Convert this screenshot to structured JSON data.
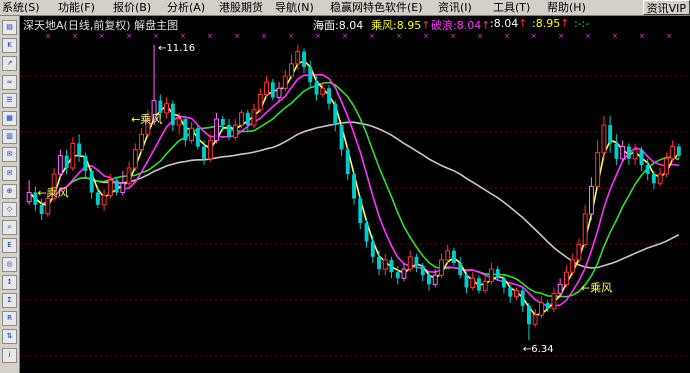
{
  "menu": {
    "items": [
      "系统(S)",
      "功能(F)",
      "报价(B)",
      "分析(A)",
      "港股期货",
      "导航(N)",
      "稳赢网特色软件(E)",
      "资讯(I)",
      "工具(T)",
      "帮助(H)"
    ],
    "right_button": "资讯VIP"
  },
  "chart_header": {
    "title": "深天地A(日线,前复权) 解盘主图"
  },
  "legend": {
    "haimian_label": "海面:",
    "haimian_value": "8.04",
    "chengfeng_label": "乘风:",
    "chengfeng_value": "8.95",
    "polang_label": "破浪:",
    "polang_value": "8.04",
    "v4": ":8.04",
    "v5": ":8.95",
    "v6": ":-:-"
  },
  "annotations": {
    "high_label": "11.16",
    "low_label": "6.34",
    "signal_label": "乘风"
  },
  "colors": {
    "up": "#ff3333",
    "down": "#00cccc",
    "ma_green": "#33dd33",
    "ma_magenta": "#ff33ff",
    "ma_white": "#c8c8c8",
    "ma_yellow": "#ffff66",
    "grid": "#7a0000",
    "haimian": "#ffffff",
    "chengfeng": "#ffff00",
    "polang": "#ff33ff"
  },
  "toolbar_icons": [
    "chart-icon",
    "k-line-icon",
    "trend-icon",
    "ma-icon",
    "list-icon",
    "grid-icon",
    "report-icon",
    "news-icon",
    "mail-icon",
    "zoom-icon",
    "filter-icon",
    "search-icon",
    "etf-icon",
    "cycle-icon",
    "rank-icon",
    "sum-icon",
    "rsi-icon",
    "sort-icon",
    "info-icon"
  ],
  "chart_data": {
    "type": "candlestick",
    "price_range": [
      6.0,
      11.5
    ],
    "candles": [
      [
        8.6,
        8.75,
        8.55,
        8.95
      ],
      [
        8.75,
        8.55,
        8.45,
        8.85
      ],
      [
        8.55,
        8.4,
        8.3,
        8.65
      ],
      [
        8.4,
        8.65,
        8.35,
        8.75
      ],
      [
        8.65,
        9.05,
        8.6,
        9.15
      ],
      [
        9.05,
        9.35,
        9.0,
        9.45
      ],
      [
        9.35,
        9.15,
        9.05,
        9.45
      ],
      [
        9.15,
        9.55,
        9.1,
        9.65
      ],
      [
        9.55,
        9.35,
        9.25,
        9.7
      ],
      [
        9.35,
        9.1,
        9.0,
        9.4
      ],
      [
        9.1,
        8.75,
        8.65,
        9.15
      ],
      [
        8.75,
        8.55,
        8.5,
        8.85
      ],
      [
        8.55,
        8.7,
        8.45,
        8.8
      ],
      [
        8.7,
        8.95,
        8.65,
        9.05
      ],
      [
        8.95,
        8.75,
        8.7,
        9.0
      ],
      [
        8.75,
        8.9,
        8.7,
        9.1
      ],
      [
        8.9,
        9.15,
        8.85,
        9.25
      ],
      [
        9.15,
        9.45,
        9.1,
        9.55
      ],
      [
        9.45,
        9.7,
        9.4,
        9.8
      ],
      [
        9.7,
        9.95,
        9.65,
        10.1
      ],
      [
        9.95,
        10.25,
        9.85,
        11.16
      ],
      [
        10.25,
        10.05,
        9.95,
        10.35
      ],
      [
        10.05,
        10.2,
        9.95,
        10.3
      ],
      [
        10.2,
        9.85,
        9.75,
        10.25
      ],
      [
        9.85,
        9.95,
        9.7,
        10.05
      ],
      [
        9.95,
        9.6,
        9.5,
        10.0
      ],
      [
        9.6,
        9.8,
        9.55,
        9.9
      ],
      [
        9.8,
        9.5,
        9.45,
        9.85
      ],
      [
        9.5,
        9.3,
        9.2,
        9.6
      ],
      [
        9.3,
        9.6,
        9.25,
        9.7
      ],
      [
        9.6,
        9.95,
        9.55,
        10.05
      ],
      [
        9.95,
        9.85,
        9.75,
        10.0
      ],
      [
        9.85,
        9.65,
        9.6,
        9.95
      ],
      [
        9.65,
        9.85,
        9.6,
        9.95
      ],
      [
        9.85,
        10.05,
        9.8,
        10.1
      ],
      [
        10.05,
        9.85,
        9.75,
        10.1
      ],
      [
        9.85,
        10.1,
        9.8,
        10.2
      ],
      [
        10.1,
        10.35,
        10.05,
        10.45
      ],
      [
        10.35,
        10.55,
        10.3,
        10.65
      ],
      [
        10.55,
        10.3,
        10.25,
        10.6
      ],
      [
        10.3,
        10.45,
        10.25,
        10.55
      ],
      [
        10.45,
        10.65,
        10.4,
        10.75
      ],
      [
        10.65,
        10.85,
        10.6,
        11.0
      ],
      [
        10.85,
        11.05,
        10.75,
        11.16
      ],
      [
        11.05,
        10.8,
        10.7,
        11.1
      ],
      [
        10.8,
        10.55,
        10.45,
        10.9
      ],
      [
        10.55,
        10.35,
        10.25,
        10.65
      ],
      [
        10.35,
        10.45,
        10.3,
        10.55
      ],
      [
        10.45,
        10.2,
        10.1,
        10.5
      ],
      [
        10.2,
        9.85,
        9.75,
        10.25
      ],
      [
        9.85,
        9.45,
        9.35,
        9.9
      ],
      [
        9.45,
        9.05,
        8.95,
        9.5
      ],
      [
        9.05,
        8.65,
        8.55,
        9.1
      ],
      [
        8.65,
        8.25,
        8.15,
        8.7
      ],
      [
        8.25,
        7.95,
        7.85,
        8.3
      ],
      [
        7.95,
        7.7,
        7.6,
        8.05
      ],
      [
        7.7,
        7.5,
        7.4,
        7.8
      ],
      [
        7.5,
        7.65,
        7.4,
        7.75
      ],
      [
        7.65,
        7.45,
        7.35,
        7.7
      ],
      [
        7.45,
        7.35,
        7.25,
        7.55
      ],
      [
        7.35,
        7.5,
        7.3,
        7.6
      ],
      [
        7.5,
        7.7,
        7.45,
        7.8
      ],
      [
        7.7,
        7.55,
        7.45,
        7.75
      ],
      [
        7.55,
        7.4,
        7.3,
        7.6
      ],
      [
        7.4,
        7.25,
        7.15,
        7.45
      ],
      [
        7.25,
        7.4,
        7.2,
        7.5
      ],
      [
        7.4,
        7.65,
        7.35,
        7.75
      ],
      [
        7.65,
        7.8,
        7.6,
        7.9
      ],
      [
        7.8,
        7.6,
        7.55,
        7.85
      ],
      [
        7.6,
        7.4,
        7.35,
        7.7
      ],
      [
        7.4,
        7.2,
        7.1,
        7.45
      ],
      [
        7.2,
        7.35,
        7.15,
        7.45
      ],
      [
        7.35,
        7.15,
        7.1,
        7.4
      ],
      [
        7.15,
        7.3,
        7.1,
        7.4
      ],
      [
        7.3,
        7.5,
        7.25,
        7.6
      ],
      [
        7.5,
        7.35,
        7.3,
        7.55
      ],
      [
        7.35,
        7.2,
        7.1,
        7.4
      ],
      [
        7.2,
        7.05,
        6.95,
        7.25
      ],
      [
        7.05,
        7.15,
        7.0,
        7.2
      ],
      [
        7.15,
        6.9,
        6.8,
        7.2
      ],
      [
        6.9,
        6.6,
        6.34,
        6.95
      ],
      [
        6.6,
        6.75,
        6.55,
        6.85
      ],
      [
        6.75,
        6.95,
        6.7,
        7.05
      ],
      [
        6.95,
        6.85,
        6.8,
        7.0
      ],
      [
        6.85,
        7.1,
        6.8,
        7.2
      ],
      [
        7.1,
        7.25,
        7.05,
        7.35
      ],
      [
        7.25,
        7.45,
        7.2,
        7.55
      ],
      [
        7.45,
        7.65,
        7.4,
        7.75
      ],
      [
        7.65,
        7.9,
        7.6,
        8.0
      ],
      [
        7.9,
        8.4,
        7.85,
        8.55
      ],
      [
        8.4,
        8.85,
        8.3,
        9.0
      ],
      [
        8.85,
        9.4,
        8.8,
        9.6
      ],
      [
        9.4,
        9.85,
        9.3,
        10.0
      ],
      [
        9.85,
        9.55,
        9.4,
        10.0
      ],
      [
        9.55,
        9.3,
        9.2,
        9.7
      ],
      [
        9.3,
        9.5,
        9.25,
        9.6
      ],
      [
        9.5,
        9.3,
        9.2,
        9.55
      ],
      [
        9.3,
        9.45,
        9.2,
        9.55
      ],
      [
        9.45,
        9.2,
        9.1,
        9.5
      ],
      [
        9.2,
        9.05,
        8.95,
        9.3
      ],
      [
        9.05,
        8.9,
        8.8,
        9.1
      ],
      [
        8.9,
        9.05,
        8.85,
        9.15
      ],
      [
        9.05,
        9.3,
        9.0,
        9.4
      ],
      [
        9.3,
        9.5,
        9.25,
        9.6
      ],
      [
        9.5,
        9.35,
        9.3,
        9.55
      ]
    ]
  }
}
